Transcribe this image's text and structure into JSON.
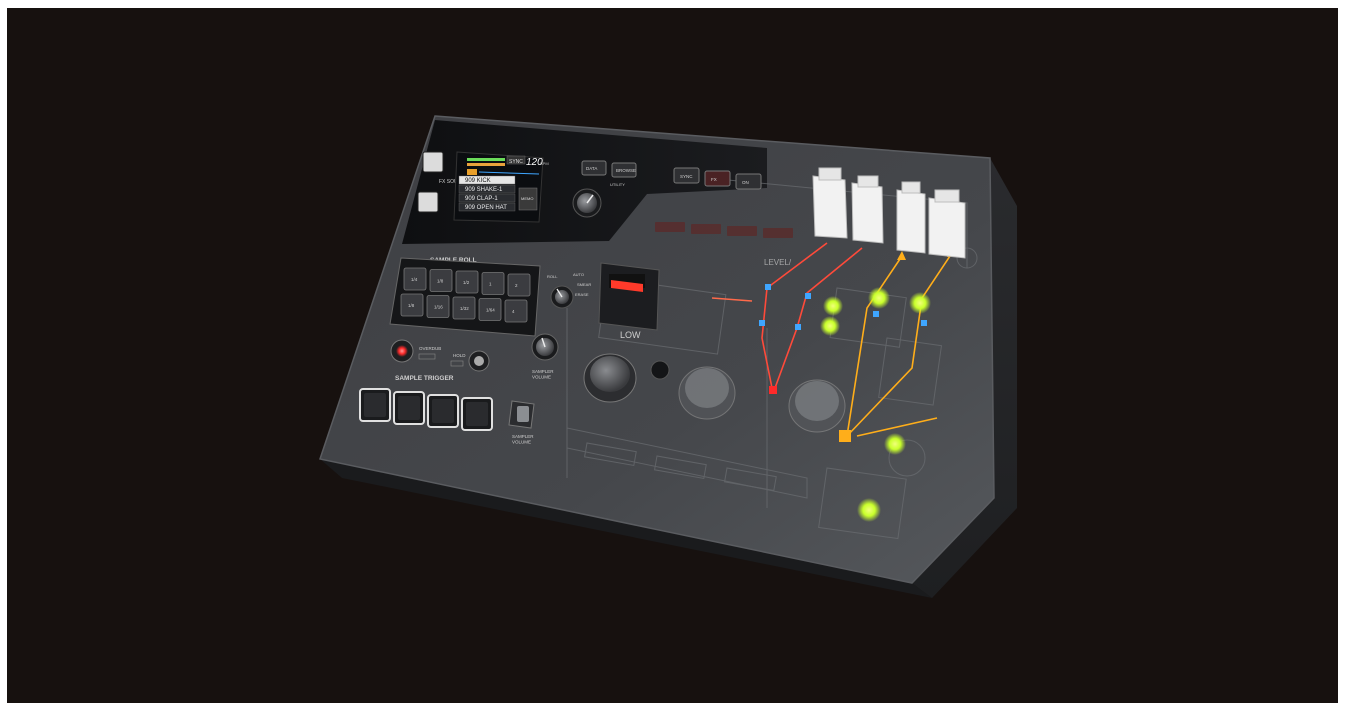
{
  "device": {
    "section_labels": {
      "sample_roll": "SAMPLE ROLL",
      "sample_trigger": "SAMPLE TRIGGER",
      "fx_source": "FX\nSOURCE",
      "utility": "UTILITY",
      "low": "LOW",
      "level_partial": "LEVEL/",
      "sampler_volume_1": "SAMPLER\nVOLUME",
      "sampler_volume_2": "SAMPLER\nVOLUME",
      "overdub": "OVERDUB",
      "hold": "HOLD"
    },
    "screen": {
      "bpm_value": "120",
      "bpm_unit": "BPM",
      "sync_label": "SYNC",
      "sample_list": [
        "909 KICK",
        "909 SHAKE-1",
        "909 CLAP-1",
        "909 OPEN HAT"
      ],
      "side_label": "MEMO"
    },
    "top_buttons": [
      "DATA",
      "BROWSE"
    ],
    "sync_buttons": [
      "SYNC",
      "FX",
      "ON"
    ],
    "roll_pads_row1": [
      "1/4",
      "1/8",
      "1/2",
      "1",
      "2"
    ],
    "roll_pads_row2": [
      "1/8",
      "1/16",
      "1/32",
      "1/64",
      "4"
    ],
    "mode_knob_labels": [
      "ROLL",
      "AUTO",
      "SMEAR",
      "ERASE"
    ],
    "colors": {
      "background": "#17110f",
      "body": "#3a3b3e",
      "panel_dark": "#111214",
      "led_red": "#ff2a2a",
      "led_blue": "#3fa6ff",
      "led_yellow_green": "#c9ff2b",
      "led_orange": "#ffae1a",
      "connector_white": "#f2f2f2"
    }
  }
}
